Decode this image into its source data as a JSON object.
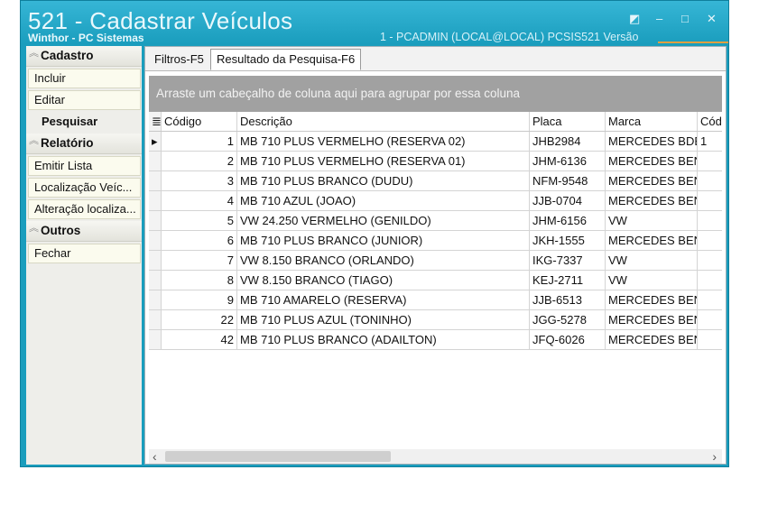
{
  "window": {
    "title": "521 - Cadastrar Veículos",
    "subtitle": "Winthor - PC Sistemas",
    "info": "1 - PCADMIN (LOCAL@LOCAL)  PCSIS521  Versão",
    "controls": {
      "restore": "◩",
      "minimize": "–",
      "maximize": "□",
      "close": "✕"
    }
  },
  "sidebar": {
    "groups": [
      {
        "title": "Cadastro",
        "items": [
          "Incluir",
          "Editar",
          "Pesquisar"
        ]
      },
      {
        "title": "Relatório",
        "items": [
          "Emitir Lista",
          "Localização Veíc...",
          "Alteração localiza..."
        ]
      },
      {
        "title": "Outros",
        "items": [
          "Fechar"
        ]
      }
    ],
    "active_item": "Pesquisar"
  },
  "tabs": [
    "Filtros-F5",
    "Resultado da Pesquisa-F6"
  ],
  "selected_tab": "Resultado da Pesquisa-F6",
  "group_panel_text": "Arraste um cabeçalho de coluna aqui para agrupar por essa coluna",
  "grid": {
    "columns": [
      "Código",
      "Descrição",
      "Placa",
      "Marca",
      "Cód"
    ],
    "rows": [
      [
        "1",
        "MB 710 PLUS VERMELHO (RESERVA 02)",
        "JHB2984",
        "MERCEDES BDE",
        "1"
      ],
      [
        "2",
        "MB 710 PLUS VERMELHO (RESERVA 01)",
        "JHM-6136",
        "MERCEDES BEN",
        ""
      ],
      [
        "3",
        "MB 710 PLUS BRANCO (DUDU)",
        "NFM-9548",
        "MERCEDES BEN",
        ""
      ],
      [
        "4",
        "MB 710 AZUL (JOAO)",
        "JJB-0704",
        "MERCEDES BEN",
        ""
      ],
      [
        "5",
        "VW 24.250 VERMELHO (GENILDO)",
        "JHM-6156",
        "VW",
        ""
      ],
      [
        "6",
        "MB 710 PLUS BRANCO (JUNIOR)",
        "JKH-1555",
        "MERCEDES BEN",
        ""
      ],
      [
        "7",
        "VW 8.150 BRANCO (ORLANDO)",
        "IKG-7337",
        "VW",
        ""
      ],
      [
        "8",
        "VW 8.150 BRANCO (TIAGO)",
        "KEJ-2711",
        "VW",
        ""
      ],
      [
        "9",
        "MB 710 AMARELO (RESERVA)",
        "JJB-6513",
        "MERCEDES BEN",
        ""
      ],
      [
        "22",
        "MB 710 PLUS AZUL (TONINHO)",
        "JGG-5278",
        "MERCEDES BEN",
        ""
      ],
      [
        "42",
        "MB 710 PLUS BRANCO (ADAILTON)",
        "JFQ-6026",
        "MERCEDES BEN",
        ""
      ]
    ]
  },
  "icons": {
    "collapse": "chevron-up-double-icon",
    "row_pointer": "row-pointer-icon",
    "column_menu": "column-menu-icon"
  },
  "colors": {
    "titlebar": "#1a9dbd",
    "group_panel": "#a1a1a1"
  }
}
